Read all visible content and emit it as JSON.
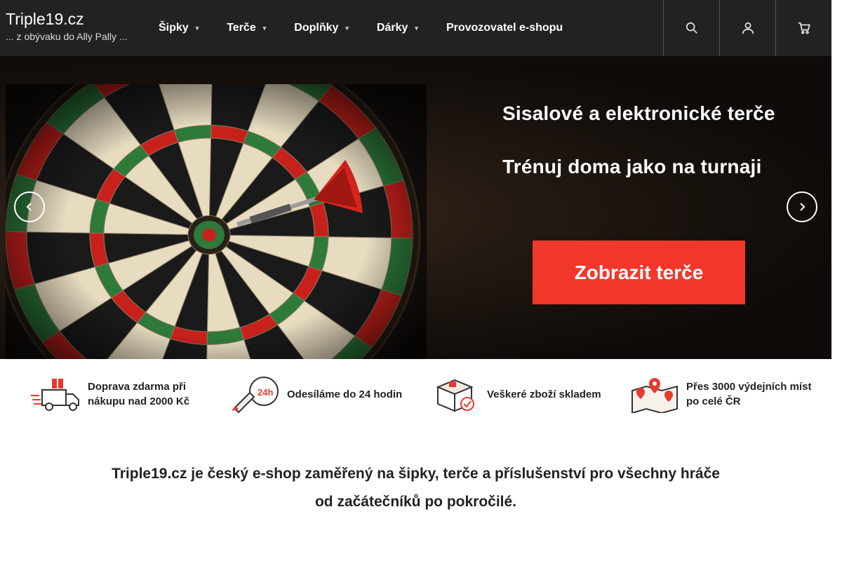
{
  "header": {
    "title": "Triple19.cz",
    "tagline": "... z obývaku do Ally Pally ...",
    "nav": [
      {
        "label": "Šipky",
        "has_dropdown": true
      },
      {
        "label": "Terče",
        "has_dropdown": true
      },
      {
        "label": "Doplňky",
        "has_dropdown": true
      },
      {
        "label": "Dárky",
        "has_dropdown": true
      },
      {
        "label": "Provozovatel e-shopu",
        "has_dropdown": false
      }
    ],
    "icons": [
      "search-icon",
      "user-icon",
      "cart-icon"
    ]
  },
  "hero": {
    "headline_1": "Sisalové a elektronické terče",
    "headline_2": "Trénuj doma jako na turnaji",
    "cta_label": "Zobrazit terče",
    "prev_icon": "chevron-left-icon",
    "next_icon": "chevron-right-icon"
  },
  "features": [
    {
      "icon": "delivery-truck-icon",
      "text": "Doprava zdarma při nákupu nad 2000 Kč"
    },
    {
      "icon": "rocket-24h-icon",
      "text": "Odesíláme do 24 hodin"
    },
    {
      "icon": "package-check-icon",
      "text": "Veškeré zboží skladem"
    },
    {
      "icon": "map-pins-icon",
      "text": "Přes 3000 výdejních míst po celé ČR"
    }
  ],
  "intro": {
    "line_1": "Triple19.cz je český e-shop zaměřený na šipky, terče a příslušenství pro všechny hráče",
    "line_2": "od začátečníků po pokročilé."
  },
  "colors": {
    "topbar": "#222222",
    "cta": "#f2372c",
    "accent_red": "#e53a2f"
  }
}
